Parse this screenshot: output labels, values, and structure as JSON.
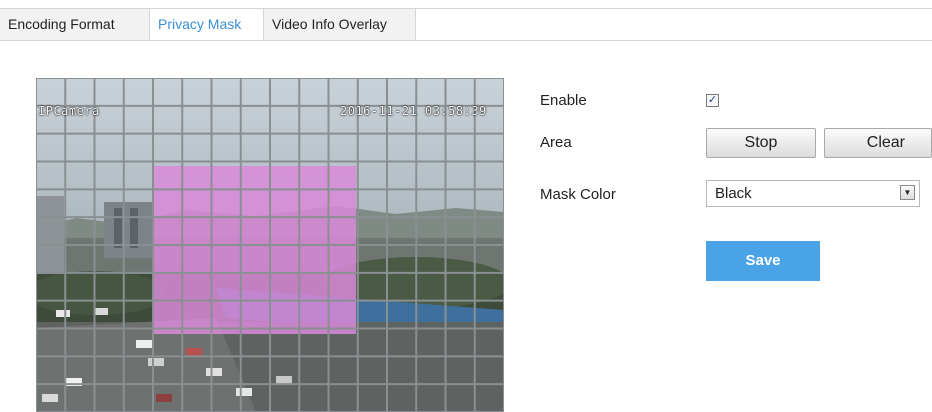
{
  "tabs": [
    {
      "label": "Encoding Format"
    },
    {
      "label": "Privacy Mask",
      "active": true
    },
    {
      "label": "Video Info Overlay"
    }
  ],
  "preview": {
    "osd_name": "IPCamera",
    "osd_datetime": "2016-11-21 03:58:39",
    "mask_color": "#d98ad9"
  },
  "form": {
    "enable_label": "Enable",
    "enable_checked": true,
    "area_label": "Area",
    "stop_label": "Stop",
    "clear_label": "Clear",
    "mask_color_label": "Mask Color",
    "mask_color_value": "Black",
    "save_label": "Save"
  },
  "colors": {
    "accent": "#4aa3e6",
    "active_tab_text": "#3a8fd8"
  }
}
